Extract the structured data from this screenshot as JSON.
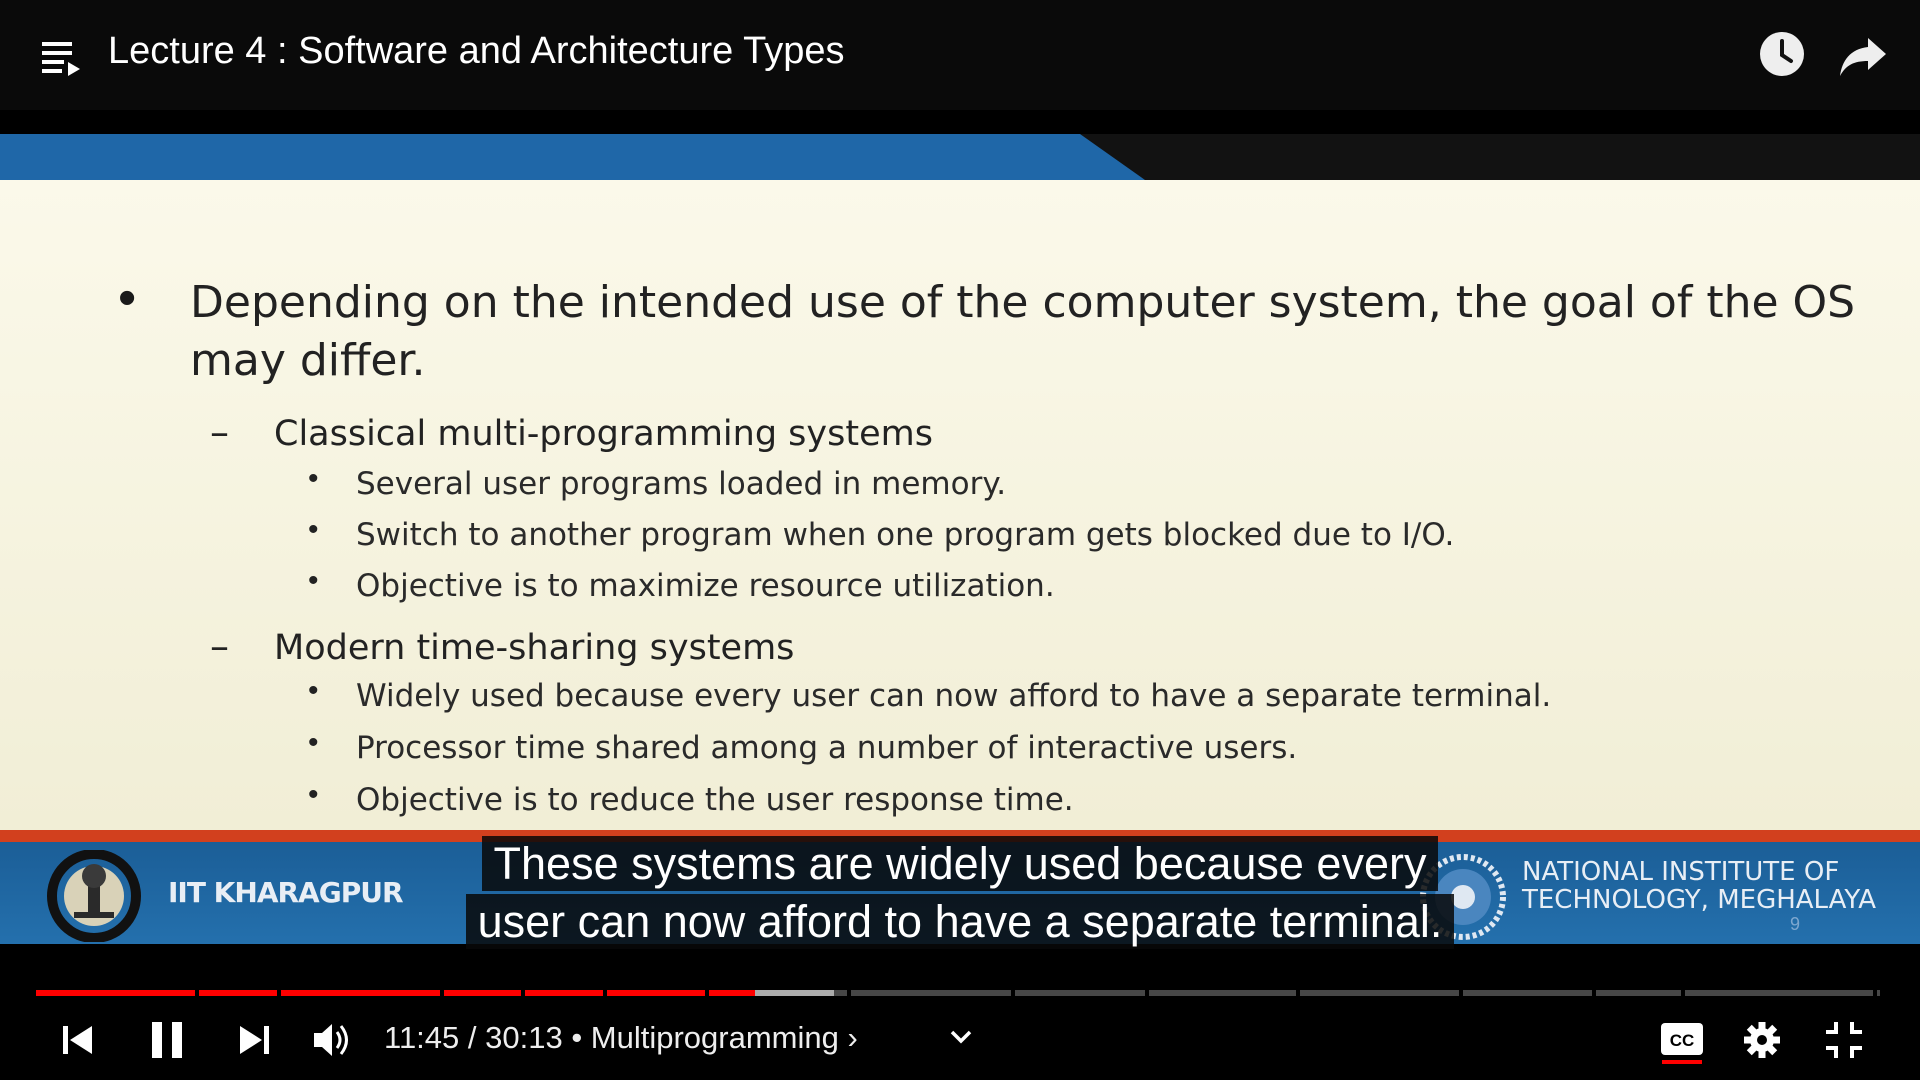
{
  "header": {
    "title": "Lecture 4 : Software and Architecture Types",
    "icons": [
      "playlist-icon",
      "watch-later-icon",
      "share-icon"
    ]
  },
  "slide": {
    "bullet1": "Depending on the intended use of the computer system, the goal of the OS may differ.",
    "sections": [
      {
        "heading": "Classical multi-programming systems",
        "items": [
          "Several user programs loaded in memory.",
          "Switch to another program when one program gets blocked due to I/O.",
          "Objective is to maximize resource utilization."
        ]
      },
      {
        "heading": "Modern time-sharing systems",
        "items": [
          "Widely used because every user can now afford to have a separate terminal.",
          "Processor time shared among a number of interactive users.",
          "Objective is to reduce the user response time."
        ]
      }
    ],
    "footer": {
      "left_org": "IIT KHARAGPUR",
      "right_org_line1": "NATIONAL INSTITUTE OF",
      "right_org_line2": "TECHNOLOGY, MEGHALAYA",
      "page": "9"
    }
  },
  "captions": {
    "line1": "These systems are widely used because every",
    "line2": "user can now afford to have a separate terminal."
  },
  "player": {
    "time_current": "11:45",
    "time_total": "30:13",
    "time_display": "11:45 / 30:13",
    "chapter": "Multiprogramming",
    "chapter_display": "• Multiprogramming ›",
    "progress_fraction": 0.389,
    "buffer_fraction": 0.432,
    "chapter_markers_seconds": [
      0,
      160,
      240,
      400,
      480,
      560,
      660,
      800,
      960,
      1092,
      1240,
      1400,
      1530,
      1618,
      1806
    ],
    "accent_color": "#ff0000"
  }
}
